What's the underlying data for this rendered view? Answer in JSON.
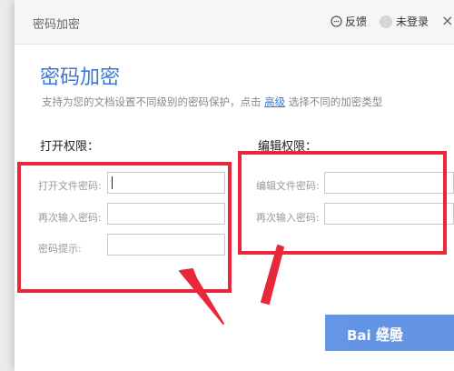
{
  "titlebar": {
    "title": "密码加密",
    "feedback": "反馈",
    "login": "未登录",
    "close": "×"
  },
  "heading": "密码加密",
  "description": {
    "before": "支持为您的文档设置不同级别的密码保护，点击 ",
    "link": "高级",
    "after": " 选择不同的加密类型"
  },
  "open_section": {
    "title": "打开权限：",
    "fields": [
      {
        "label": "打开文件密码:",
        "value": ""
      },
      {
        "label": "再次输入密码:",
        "value": ""
      },
      {
        "label": "密码提示:",
        "value": ""
      }
    ]
  },
  "edit_section": {
    "title": "编辑权限：",
    "fields": [
      {
        "label": "编辑文件密码:",
        "value": ""
      },
      {
        "label": "再次输入密码:",
        "value": ""
      }
    ]
  },
  "apply_button": "应用",
  "watermark": "Bai 经验",
  "colors": {
    "accent": "#3a78d4",
    "highlight": "#e8283a",
    "button": "#4a82e0"
  }
}
